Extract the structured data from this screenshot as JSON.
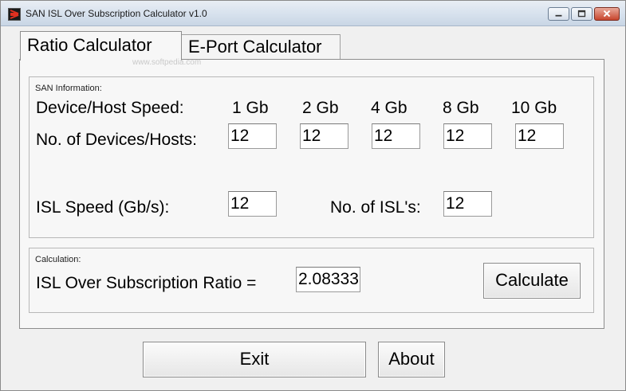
{
  "window": {
    "title": "SAN ISL Over Subscription Calculator v1.0",
    "watermark": "www.softpedia.com"
  },
  "tabs": [
    {
      "label": "Ratio Calculator",
      "active": true
    },
    {
      "label": "E-Port Calculator",
      "active": false
    }
  ],
  "san_info": {
    "caption": "SAN Information:",
    "speed_label": "Device/Host Speed:",
    "speeds": [
      "1 Gb",
      "2 Gb",
      "4 Gb",
      "8 Gb",
      "10 Gb"
    ],
    "devices_label": "No. of Devices/Hosts:",
    "device_counts": [
      "12",
      "12",
      "12",
      "12",
      "12"
    ],
    "isl_speed_label": "ISL Speed (Gb/s):",
    "isl_speed_value": "12",
    "isl_count_label": "No. of ISL's:",
    "isl_count_value": "12"
  },
  "calculation": {
    "caption": "Calculation:",
    "ratio_label": "ISL Over Subscription Ratio =",
    "ratio_value": "2.08333",
    "calculate_label": "Calculate"
  },
  "footer": {
    "exit_label": "Exit",
    "about_label": "About"
  },
  "colors": {
    "window_bg": "#f0f0f0",
    "close_button": "#c7452d"
  }
}
